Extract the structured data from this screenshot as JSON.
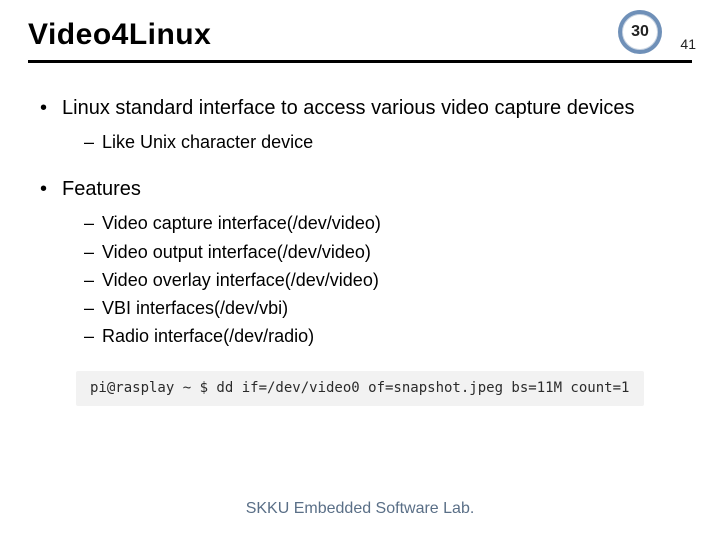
{
  "header": {
    "title": "Video4Linux",
    "current_page": "30",
    "total_pages": "41"
  },
  "content": {
    "bullets": [
      {
        "text": "Linux standard interface to access various video capture devices",
        "sub": [
          "Like Unix character device"
        ]
      },
      {
        "text": "Features",
        "sub": [
          "Video capture interface(/dev/video)",
          "Video output interface(/dev/video)",
          "Video overlay interface(/dev/video)",
          "VBI interfaces(/dev/vbi)",
          "Radio interface(/dev/radio)"
        ]
      }
    ],
    "terminal": "pi@rasplay ~ $ dd if=/dev/video0 of=snapshot.jpeg bs=11M count=1"
  },
  "footer": {
    "text": "SKKU Embedded Software Lab."
  }
}
